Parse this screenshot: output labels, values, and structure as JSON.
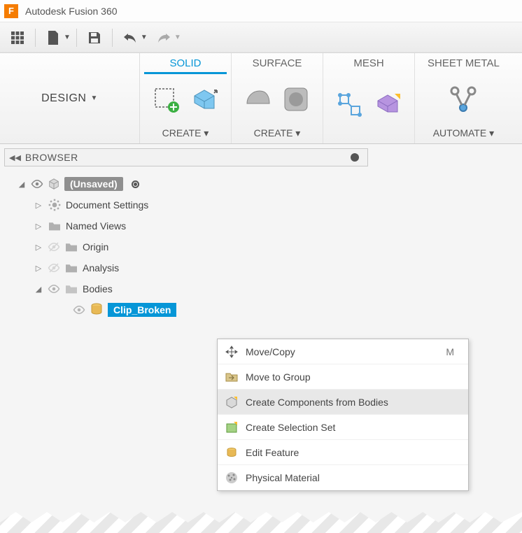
{
  "app": {
    "title": "Autodesk Fusion 360",
    "app_initial": "F"
  },
  "quickbar": {
    "icons": [
      "grid-icon",
      "new-file-icon",
      "save-icon",
      "undo-icon",
      "redo-icon"
    ]
  },
  "ribbon": {
    "design_label": "DESIGN",
    "tabs": [
      {
        "label": "SOLID",
        "active": true,
        "footer": "CREATE ▾"
      },
      {
        "label": "SURFACE",
        "active": false,
        "footer": "CREATE ▾"
      },
      {
        "label": "MESH",
        "active": false,
        "footer": ""
      },
      {
        "label": "SHEET METAL",
        "active": false,
        "footer": "AUTOMATE ▾"
      }
    ]
  },
  "browser": {
    "title": "BROWSER",
    "root": "(Unsaved)",
    "items": [
      {
        "label": "Document Settings",
        "icon": "gear-icon",
        "expanded": false,
        "dim": false
      },
      {
        "label": "Named Views",
        "icon": "folder-icon",
        "expanded": false,
        "dim": false
      },
      {
        "label": "Origin",
        "icon": "folder-icon",
        "expanded": false,
        "dim": true
      },
      {
        "label": "Analysis",
        "icon": "folder-icon",
        "expanded": false,
        "dim": true
      },
      {
        "label": "Bodies",
        "icon": "folder-icon",
        "expanded": true,
        "dim": true
      }
    ],
    "bodies": [
      {
        "label": "Clip_Broken",
        "selected": true
      }
    ]
  },
  "context_menu": {
    "items": [
      {
        "label": "Move/Copy",
        "icon": "move-icon",
        "shortcut": "M",
        "hover": false
      },
      {
        "label": "Move to Group",
        "icon": "folder-move-icon",
        "shortcut": "",
        "hover": false
      },
      {
        "label": "Create Components from Bodies",
        "icon": "component-icon",
        "shortcut": "",
        "hover": true
      },
      {
        "label": "Create Selection Set",
        "icon": "selection-set-icon",
        "shortcut": "",
        "hover": false
      },
      {
        "label": "Edit Feature",
        "icon": "edit-feature-icon",
        "shortcut": "",
        "hover": false
      },
      {
        "label": "Physical Material",
        "icon": "material-icon",
        "shortcut": "",
        "hover": false
      }
    ]
  }
}
